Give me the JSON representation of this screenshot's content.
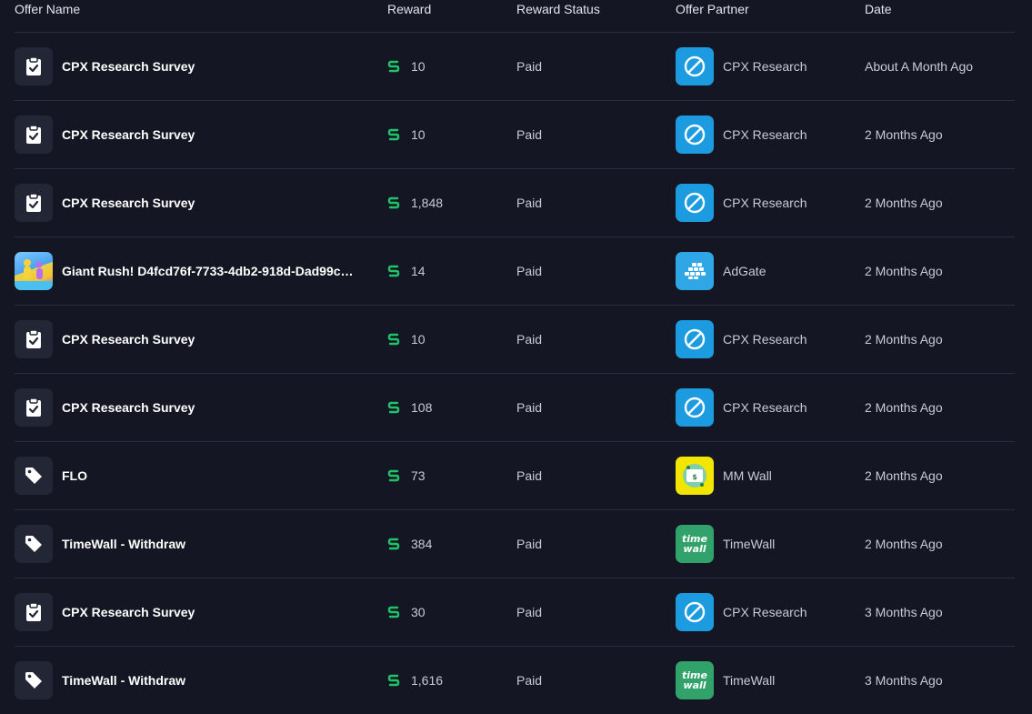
{
  "columns": {
    "offer_name": "Offer Name",
    "reward": "Reward",
    "reward_status": "Reward Status",
    "offer_partner": "Offer Partner",
    "date": "Date"
  },
  "colors": {
    "background": "#141723",
    "reward_icon": "#1fc46a",
    "cpx": "#1d9be0",
    "adgate": "#2fa7e6",
    "mmwall": "#f2e600",
    "timewall": "#31a36a"
  },
  "rows": [
    {
      "icon": "clipboard-check-icon",
      "name": "CPX Research Survey",
      "reward": "10",
      "status": "Paid",
      "partner": "CPX Research",
      "partner_logo": "cpx",
      "date": "About A Month Ago"
    },
    {
      "icon": "clipboard-check-icon",
      "name": "CPX Research Survey",
      "reward": "10",
      "status": "Paid",
      "partner": "CPX Research",
      "partner_logo": "cpx",
      "date": "2 Months Ago"
    },
    {
      "icon": "clipboard-check-icon",
      "name": "CPX Research Survey",
      "reward": "1,848",
      "status": "Paid",
      "partner": "CPX Research",
      "partner_logo": "cpx",
      "date": "2 Months Ago"
    },
    {
      "icon": "game-thumbnail",
      "name": "Giant Rush! D4fcd76f-7733-4db2-918d-Dad99c…",
      "reward": "14",
      "status": "Paid",
      "partner": "AdGate",
      "partner_logo": "adgate",
      "date": "2 Months Ago"
    },
    {
      "icon": "clipboard-check-icon",
      "name": "CPX Research Survey",
      "reward": "10",
      "status": "Paid",
      "partner": "CPX Research",
      "partner_logo": "cpx",
      "date": "2 Months Ago"
    },
    {
      "icon": "clipboard-check-icon",
      "name": "CPX Research Survey",
      "reward": "108",
      "status": "Paid",
      "partner": "CPX Research",
      "partner_logo": "cpx",
      "date": "2 Months Ago"
    },
    {
      "icon": "tag-icon",
      "name": "FLO",
      "reward": "73",
      "status": "Paid",
      "partner": "MM Wall",
      "partner_logo": "mmwall",
      "date": "2 Months Ago"
    },
    {
      "icon": "tag-icon",
      "name": "TimeWall - Withdraw",
      "reward": "384",
      "status": "Paid",
      "partner": "TimeWall",
      "partner_logo": "timewall",
      "date": "2 Months Ago"
    },
    {
      "icon": "clipboard-check-icon",
      "name": "CPX Research Survey",
      "reward": "30",
      "status": "Paid",
      "partner": "CPX Research",
      "partner_logo": "cpx",
      "date": "3 Months Ago"
    },
    {
      "icon": "tag-icon",
      "name": "TimeWall - Withdraw",
      "reward": "1,616",
      "status": "Paid",
      "partner": "TimeWall",
      "partner_logo": "timewall",
      "date": "3 Months Ago"
    }
  ]
}
